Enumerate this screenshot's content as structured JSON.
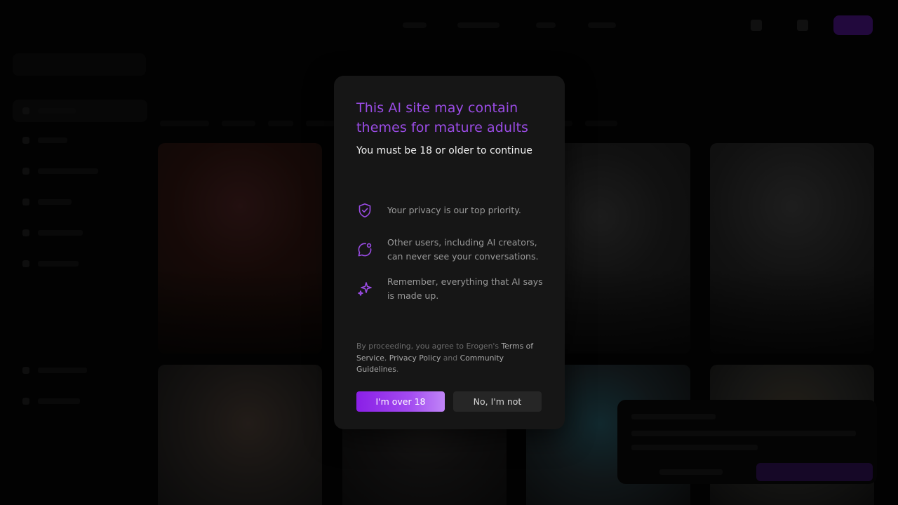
{
  "modal": {
    "title": "This AI site may contain themes for mature adults",
    "subtitle": "You must be 18 or older to continue",
    "features": [
      {
        "icon": "shield-check-icon",
        "text": "Your privacy is our top priority."
      },
      {
        "icon": "chat-bubble-icon",
        "text": "Other users, including AI creators, can never see your conversations."
      },
      {
        "icon": "sparkles-icon",
        "text": "Remember, everything that AI says is made up."
      }
    ],
    "legal": {
      "prefix": "By proceeding, you agree to Erogen's ",
      "terms": "Terms of Service",
      "comma": ", ",
      "privacy": "Privacy Policy",
      "and": " and ",
      "community": "Community Guidelines",
      "suffix": "."
    },
    "accept_label": "I'm over 18",
    "decline_label": "No, I'm not"
  },
  "colors": {
    "accent": "#9b4ce6",
    "button_gradient_start": "#8a1fe6",
    "button_gradient_end": "#c085f7",
    "modal_background": "#161616",
    "secondary_button": "#262626"
  }
}
